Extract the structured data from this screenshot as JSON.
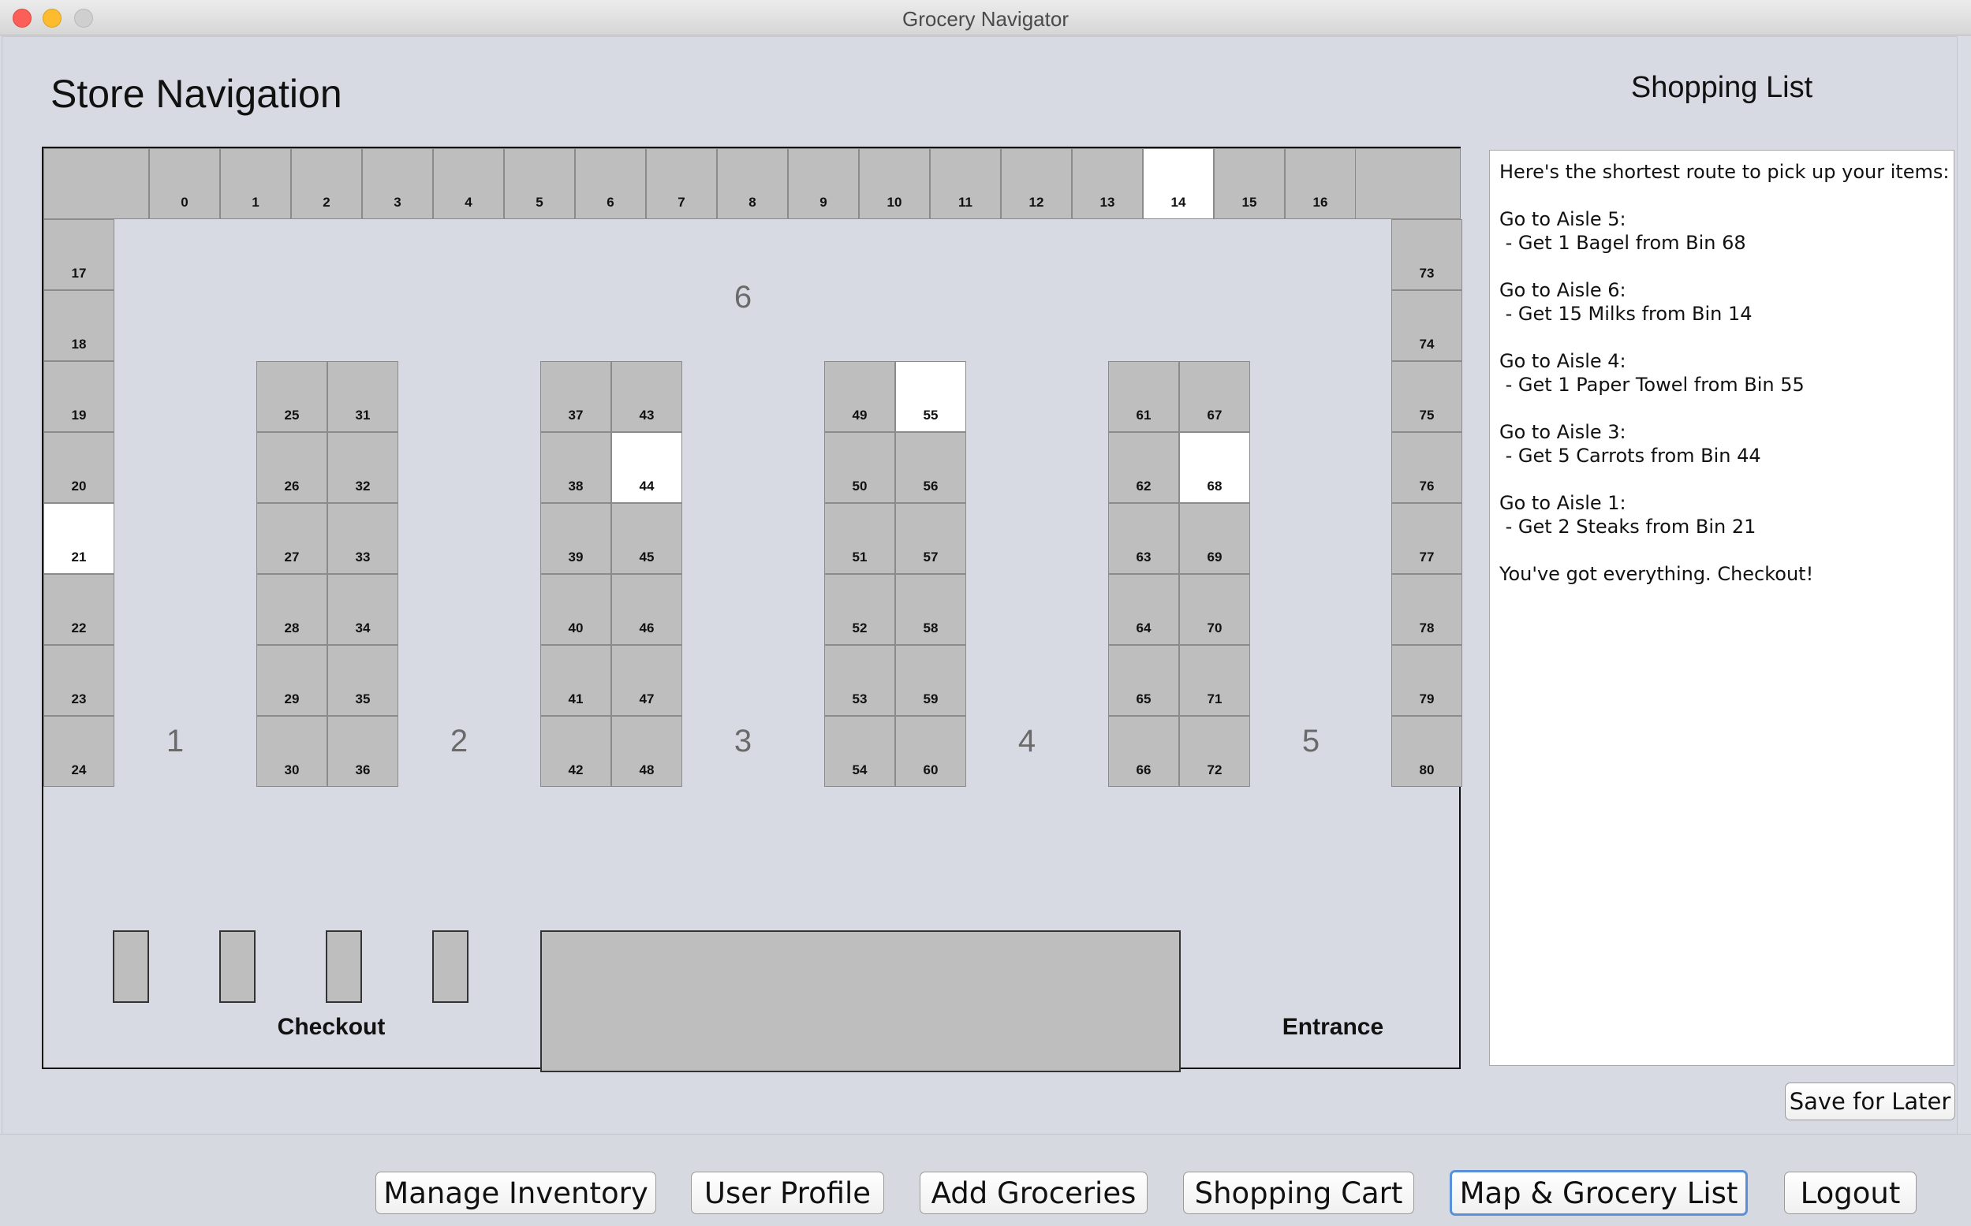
{
  "window": {
    "title": "Grocery Navigator"
  },
  "header": {
    "title": "Store Navigation",
    "list_title": "Shopping List"
  },
  "map": {
    "top_bins": [
      "0",
      "1",
      "2",
      "3",
      "4",
      "5",
      "6",
      "7",
      "8",
      "9",
      "10",
      "11",
      "12",
      "13",
      "14",
      "15",
      "16"
    ],
    "left_bins": [
      "17",
      "18",
      "19",
      "20",
      "21",
      "22",
      "23",
      "24"
    ],
    "right_bins": [
      "73",
      "74",
      "75",
      "76",
      "77",
      "78",
      "79",
      "80"
    ],
    "shelf_1": [
      "25",
      "26",
      "27",
      "28",
      "29",
      "30",
      "31",
      "32",
      "33",
      "34",
      "35",
      "36"
    ],
    "shelf_2": [
      "37",
      "38",
      "39",
      "40",
      "41",
      "42",
      "43",
      "44",
      "45",
      "46",
      "47",
      "48"
    ],
    "shelf_3": [
      "49",
      "50",
      "51",
      "52",
      "53",
      "54",
      "55",
      "56",
      "57",
      "58",
      "59",
      "60"
    ],
    "shelf_4": [
      "61",
      "62",
      "63",
      "64",
      "65",
      "66",
      "67",
      "68",
      "69",
      "70",
      "71",
      "72"
    ],
    "highlighted_bins": [
      "14",
      "21",
      "44",
      "55",
      "68"
    ],
    "aisle_labels": [
      "1",
      "2",
      "3",
      "4",
      "5",
      "6"
    ],
    "checkout_label": "Checkout",
    "entrance_label": "Entrance"
  },
  "shopping_list": {
    "lines": [
      "Here's the shortest route to pick up your items:",
      "",
      "Go to Aisle 5:",
      " - Get 1 Bagel from Bin 68",
      "",
      "Go to Aisle 6:",
      " - Get 15 Milks from Bin 14",
      "",
      "Go to Aisle 4:",
      " - Get 1 Paper Towel from Bin 55",
      "",
      "Go to Aisle 3:",
      " - Get 5 Carrots from Bin 44",
      "",
      "Go to Aisle 1:",
      " - Get 2 Steaks from Bin 21",
      "",
      "You've got everything. Checkout!"
    ]
  },
  "buttons": {
    "save_for_later": "Save for Later",
    "manage_inventory": "Manage Inventory",
    "user_profile": "User Profile",
    "add_groceries": "Add Groceries",
    "shopping_cart": "Shopping Cart",
    "map_grocery_list": "Map & Grocery List",
    "logout": "Logout"
  }
}
